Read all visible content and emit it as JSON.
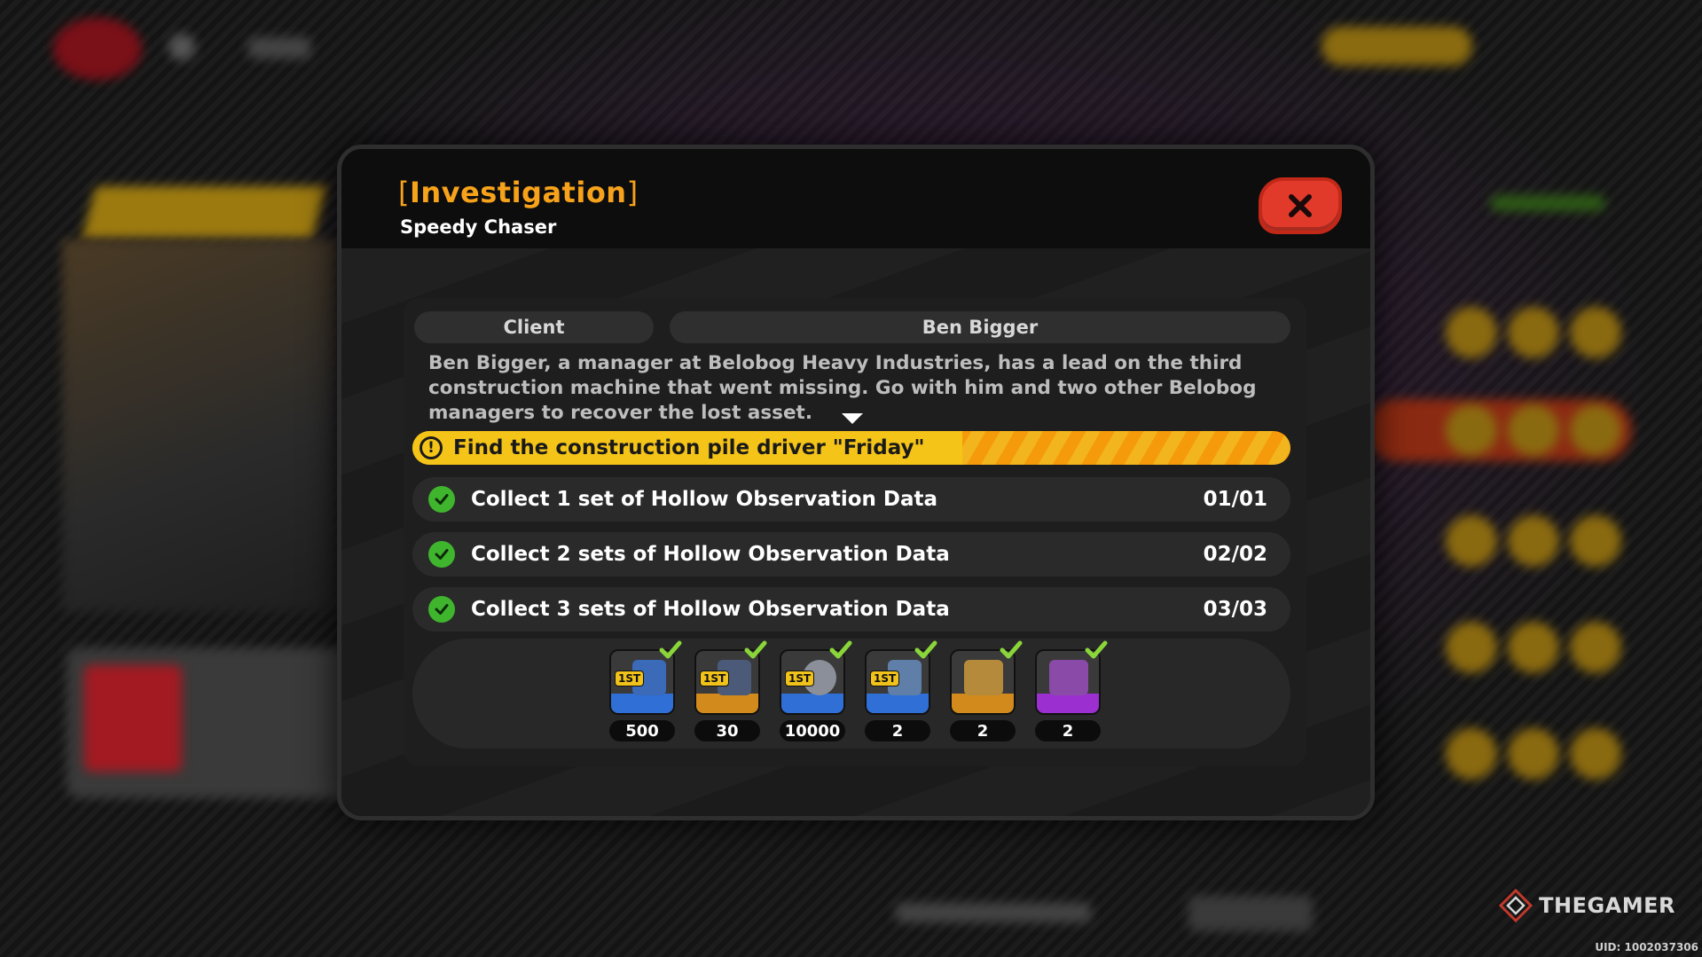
{
  "quest": {
    "category": "Investigation",
    "title": "Speedy Chaser"
  },
  "client": {
    "label": "Client",
    "name": "Ben Bigger"
  },
  "description": "Ben Bigger, a manager at Belobog Heavy Industries, has a lead on the third construction machine that went missing. Go with him and two other Belobog managers to recover the lost asset.",
  "objective": {
    "icon": "exclamation-icon",
    "text": "Find the construction pile driver \"Friday\""
  },
  "tasks": [
    {
      "text": "Collect 1 set of Hollow Observation Data",
      "count": "01/01",
      "done": true
    },
    {
      "text": "Collect 2 sets of Hollow Observation Data",
      "count": "02/02",
      "done": true
    },
    {
      "text": "Collect 3 sets of Hollow Observation Data",
      "count": "03/03",
      "done": true
    }
  ],
  "rewards": [
    {
      "qty": "500",
      "first_clear": true,
      "claimed": true,
      "color": "#2f6fd6",
      "icon": "reward-item-icon"
    },
    {
      "qty": "30",
      "first_clear": true,
      "claimed": true,
      "color": "#d18a1b",
      "icon": "reward-item-icon"
    },
    {
      "qty": "10000",
      "first_clear": true,
      "claimed": true,
      "color": "#2f6fd6",
      "icon": "reward-item-icon"
    },
    {
      "qty": "2",
      "first_clear": true,
      "claimed": true,
      "color": "#2f6fd6",
      "icon": "reward-item-icon"
    },
    {
      "qty": "2",
      "first_clear": false,
      "claimed": true,
      "color": "#d18a1b",
      "icon": "reward-item-icon"
    },
    {
      "qty": "2",
      "first_clear": false,
      "claimed": true,
      "color": "#9b2fd0",
      "icon": "reward-item-icon"
    }
  ],
  "labels": {
    "first_clear": "1ST"
  },
  "watermark": "THEGAMER",
  "uid": "UID: 1002037306",
  "colors": {
    "accent": "#f7a21b",
    "close": "#e13a2b",
    "check": "#3fb52e"
  }
}
